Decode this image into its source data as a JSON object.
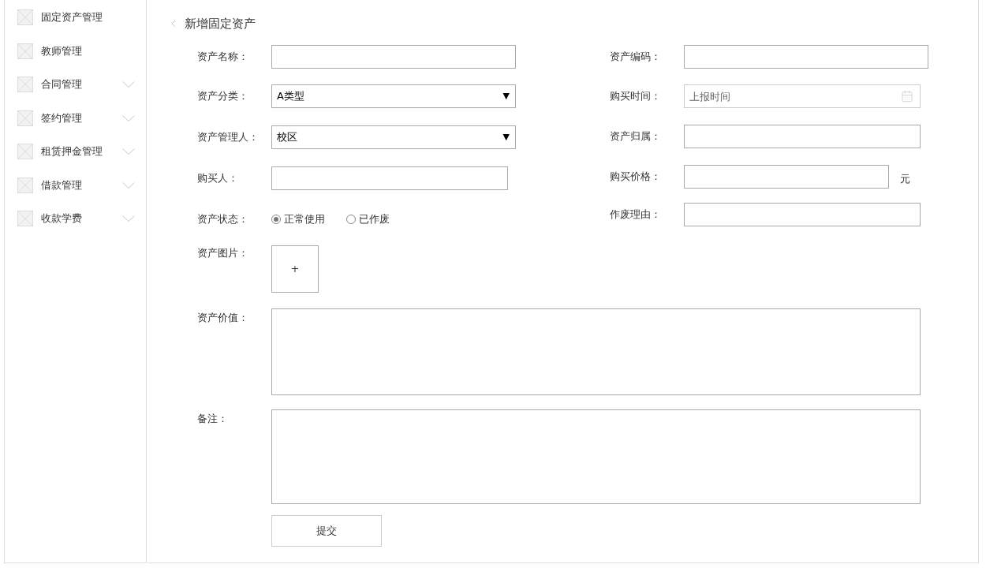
{
  "sidebar": {
    "items": [
      {
        "label": "固定资产管理",
        "expandable": false
      },
      {
        "label": "教师管理",
        "expandable": false
      },
      {
        "label": "合同管理",
        "expandable": true
      },
      {
        "label": "签约管理",
        "expandable": true
      },
      {
        "label": "租赁押金管理",
        "expandable": true
      },
      {
        "label": "借款管理",
        "expandable": true
      },
      {
        "label": "收款学费",
        "expandable": true
      }
    ]
  },
  "page": {
    "title": "新增固定资产"
  },
  "form": {
    "left": [
      {
        "kind": "text",
        "label": "资产名称："
      },
      {
        "kind": "select",
        "label": "资产分类：",
        "value": "A类型",
        "arrow": "▼"
      },
      {
        "kind": "select",
        "label": "资产管理人：",
        "value": "校区",
        "arrow": "▼"
      },
      {
        "kind": "text",
        "label": "购买人："
      },
      {
        "kind": "radio",
        "label": "资产状态：",
        "options": [
          {
            "label": "正常使用",
            "selected": true
          },
          {
            "label": "已作废",
            "selected": false
          }
        ]
      },
      {
        "kind": "upload",
        "label": "资产图片：",
        "symbol": "+"
      }
    ],
    "right": [
      {
        "kind": "text",
        "label": "资产编码："
      },
      {
        "kind": "date",
        "label": "购买时间：",
        "placeholder": "上报时间"
      },
      {
        "kind": "text",
        "label": "资产归属："
      },
      {
        "kind": "text",
        "label": "购买价格：",
        "suffix": "元"
      },
      {
        "kind": "text",
        "label": "作废理由："
      }
    ],
    "wide": [
      {
        "kind": "textarea",
        "label": "资产价值："
      },
      {
        "kind": "textarea",
        "label": "备注："
      }
    ],
    "submit": "提交"
  }
}
